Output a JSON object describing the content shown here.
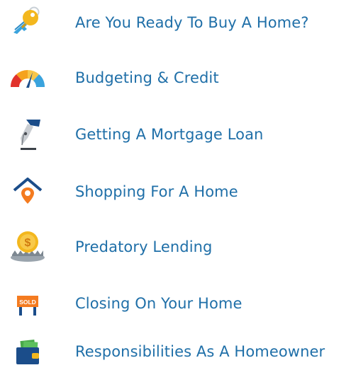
{
  "menu": {
    "items": [
      {
        "label": "Are You Ready To Buy A Home?",
        "icon": "keys-icon"
      },
      {
        "label": "Budgeting & Credit",
        "icon": "credit-gauge-icon"
      },
      {
        "label": "Getting A Mortgage Loan",
        "icon": "pen-nib-icon"
      },
      {
        "label": "Shopping For A Home",
        "icon": "house-location-icon"
      },
      {
        "label": "Predatory Lending",
        "icon": "coin-trap-icon"
      },
      {
        "label": "Closing On Your Home",
        "icon": "sold-sign-icon",
        "icon_text": "SOLD"
      },
      {
        "label": "Responsibilities As A Homeowner",
        "icon": "wallet-icon"
      }
    ]
  },
  "colors": {
    "label": "#1f6fa8",
    "key_gold": "#f3b71e",
    "key_blue": "#3aa3dd",
    "gauge_red": "#e1322b",
    "gauge_orange": "#f5a21d",
    "gauge_blue": "#3aa3dd",
    "navy": "#1b4d8a",
    "sold_orange": "#f47b20",
    "money_green": "#49a84a"
  }
}
